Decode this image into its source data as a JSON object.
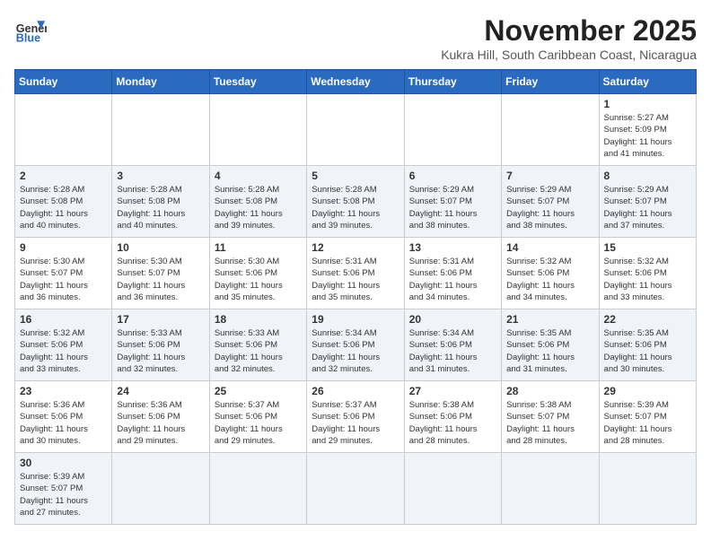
{
  "header": {
    "logo_line1": "General",
    "logo_line2": "Blue",
    "month_year": "November 2025",
    "location": "Kukra Hill, South Caribbean Coast, Nicaragua"
  },
  "days_of_week": [
    "Sunday",
    "Monday",
    "Tuesday",
    "Wednesday",
    "Thursday",
    "Friday",
    "Saturday"
  ],
  "weeks": [
    [
      {
        "day": "",
        "info": ""
      },
      {
        "day": "",
        "info": ""
      },
      {
        "day": "",
        "info": ""
      },
      {
        "day": "",
        "info": ""
      },
      {
        "day": "",
        "info": ""
      },
      {
        "day": "",
        "info": ""
      },
      {
        "day": "1",
        "info": "Sunrise: 5:27 AM\nSunset: 5:09 PM\nDaylight: 11 hours\nand 41 minutes."
      }
    ],
    [
      {
        "day": "2",
        "info": "Sunrise: 5:28 AM\nSunset: 5:08 PM\nDaylight: 11 hours\nand 40 minutes."
      },
      {
        "day": "3",
        "info": "Sunrise: 5:28 AM\nSunset: 5:08 PM\nDaylight: 11 hours\nand 40 minutes."
      },
      {
        "day": "4",
        "info": "Sunrise: 5:28 AM\nSunset: 5:08 PM\nDaylight: 11 hours\nand 39 minutes."
      },
      {
        "day": "5",
        "info": "Sunrise: 5:28 AM\nSunset: 5:08 PM\nDaylight: 11 hours\nand 39 minutes."
      },
      {
        "day": "6",
        "info": "Sunrise: 5:29 AM\nSunset: 5:07 PM\nDaylight: 11 hours\nand 38 minutes."
      },
      {
        "day": "7",
        "info": "Sunrise: 5:29 AM\nSunset: 5:07 PM\nDaylight: 11 hours\nand 38 minutes."
      },
      {
        "day": "8",
        "info": "Sunrise: 5:29 AM\nSunset: 5:07 PM\nDaylight: 11 hours\nand 37 minutes."
      }
    ],
    [
      {
        "day": "9",
        "info": "Sunrise: 5:30 AM\nSunset: 5:07 PM\nDaylight: 11 hours\nand 36 minutes."
      },
      {
        "day": "10",
        "info": "Sunrise: 5:30 AM\nSunset: 5:07 PM\nDaylight: 11 hours\nand 36 minutes."
      },
      {
        "day": "11",
        "info": "Sunrise: 5:30 AM\nSunset: 5:06 PM\nDaylight: 11 hours\nand 35 minutes."
      },
      {
        "day": "12",
        "info": "Sunrise: 5:31 AM\nSunset: 5:06 PM\nDaylight: 11 hours\nand 35 minutes."
      },
      {
        "day": "13",
        "info": "Sunrise: 5:31 AM\nSunset: 5:06 PM\nDaylight: 11 hours\nand 34 minutes."
      },
      {
        "day": "14",
        "info": "Sunrise: 5:32 AM\nSunset: 5:06 PM\nDaylight: 11 hours\nand 34 minutes."
      },
      {
        "day": "15",
        "info": "Sunrise: 5:32 AM\nSunset: 5:06 PM\nDaylight: 11 hours\nand 33 minutes."
      }
    ],
    [
      {
        "day": "16",
        "info": "Sunrise: 5:32 AM\nSunset: 5:06 PM\nDaylight: 11 hours\nand 33 minutes."
      },
      {
        "day": "17",
        "info": "Sunrise: 5:33 AM\nSunset: 5:06 PM\nDaylight: 11 hours\nand 32 minutes."
      },
      {
        "day": "18",
        "info": "Sunrise: 5:33 AM\nSunset: 5:06 PM\nDaylight: 11 hours\nand 32 minutes."
      },
      {
        "day": "19",
        "info": "Sunrise: 5:34 AM\nSunset: 5:06 PM\nDaylight: 11 hours\nand 32 minutes."
      },
      {
        "day": "20",
        "info": "Sunrise: 5:34 AM\nSunset: 5:06 PM\nDaylight: 11 hours\nand 31 minutes."
      },
      {
        "day": "21",
        "info": "Sunrise: 5:35 AM\nSunset: 5:06 PM\nDaylight: 11 hours\nand 31 minutes."
      },
      {
        "day": "22",
        "info": "Sunrise: 5:35 AM\nSunset: 5:06 PM\nDaylight: 11 hours\nand 30 minutes."
      }
    ],
    [
      {
        "day": "23",
        "info": "Sunrise: 5:36 AM\nSunset: 5:06 PM\nDaylight: 11 hours\nand 30 minutes."
      },
      {
        "day": "24",
        "info": "Sunrise: 5:36 AM\nSunset: 5:06 PM\nDaylight: 11 hours\nand 29 minutes."
      },
      {
        "day": "25",
        "info": "Sunrise: 5:37 AM\nSunset: 5:06 PM\nDaylight: 11 hours\nand 29 minutes."
      },
      {
        "day": "26",
        "info": "Sunrise: 5:37 AM\nSunset: 5:06 PM\nDaylight: 11 hours\nand 29 minutes."
      },
      {
        "day": "27",
        "info": "Sunrise: 5:38 AM\nSunset: 5:06 PM\nDaylight: 11 hours\nand 28 minutes."
      },
      {
        "day": "28",
        "info": "Sunrise: 5:38 AM\nSunset: 5:07 PM\nDaylight: 11 hours\nand 28 minutes."
      },
      {
        "day": "29",
        "info": "Sunrise: 5:39 AM\nSunset: 5:07 PM\nDaylight: 11 hours\nand 28 minutes."
      }
    ],
    [
      {
        "day": "30",
        "info": "Sunrise: 5:39 AM\nSunset: 5:07 PM\nDaylight: 11 hours\nand 27 minutes."
      },
      {
        "day": "",
        "info": ""
      },
      {
        "day": "",
        "info": ""
      },
      {
        "day": "",
        "info": ""
      },
      {
        "day": "",
        "info": ""
      },
      {
        "day": "",
        "info": ""
      },
      {
        "day": "",
        "info": ""
      }
    ]
  ]
}
